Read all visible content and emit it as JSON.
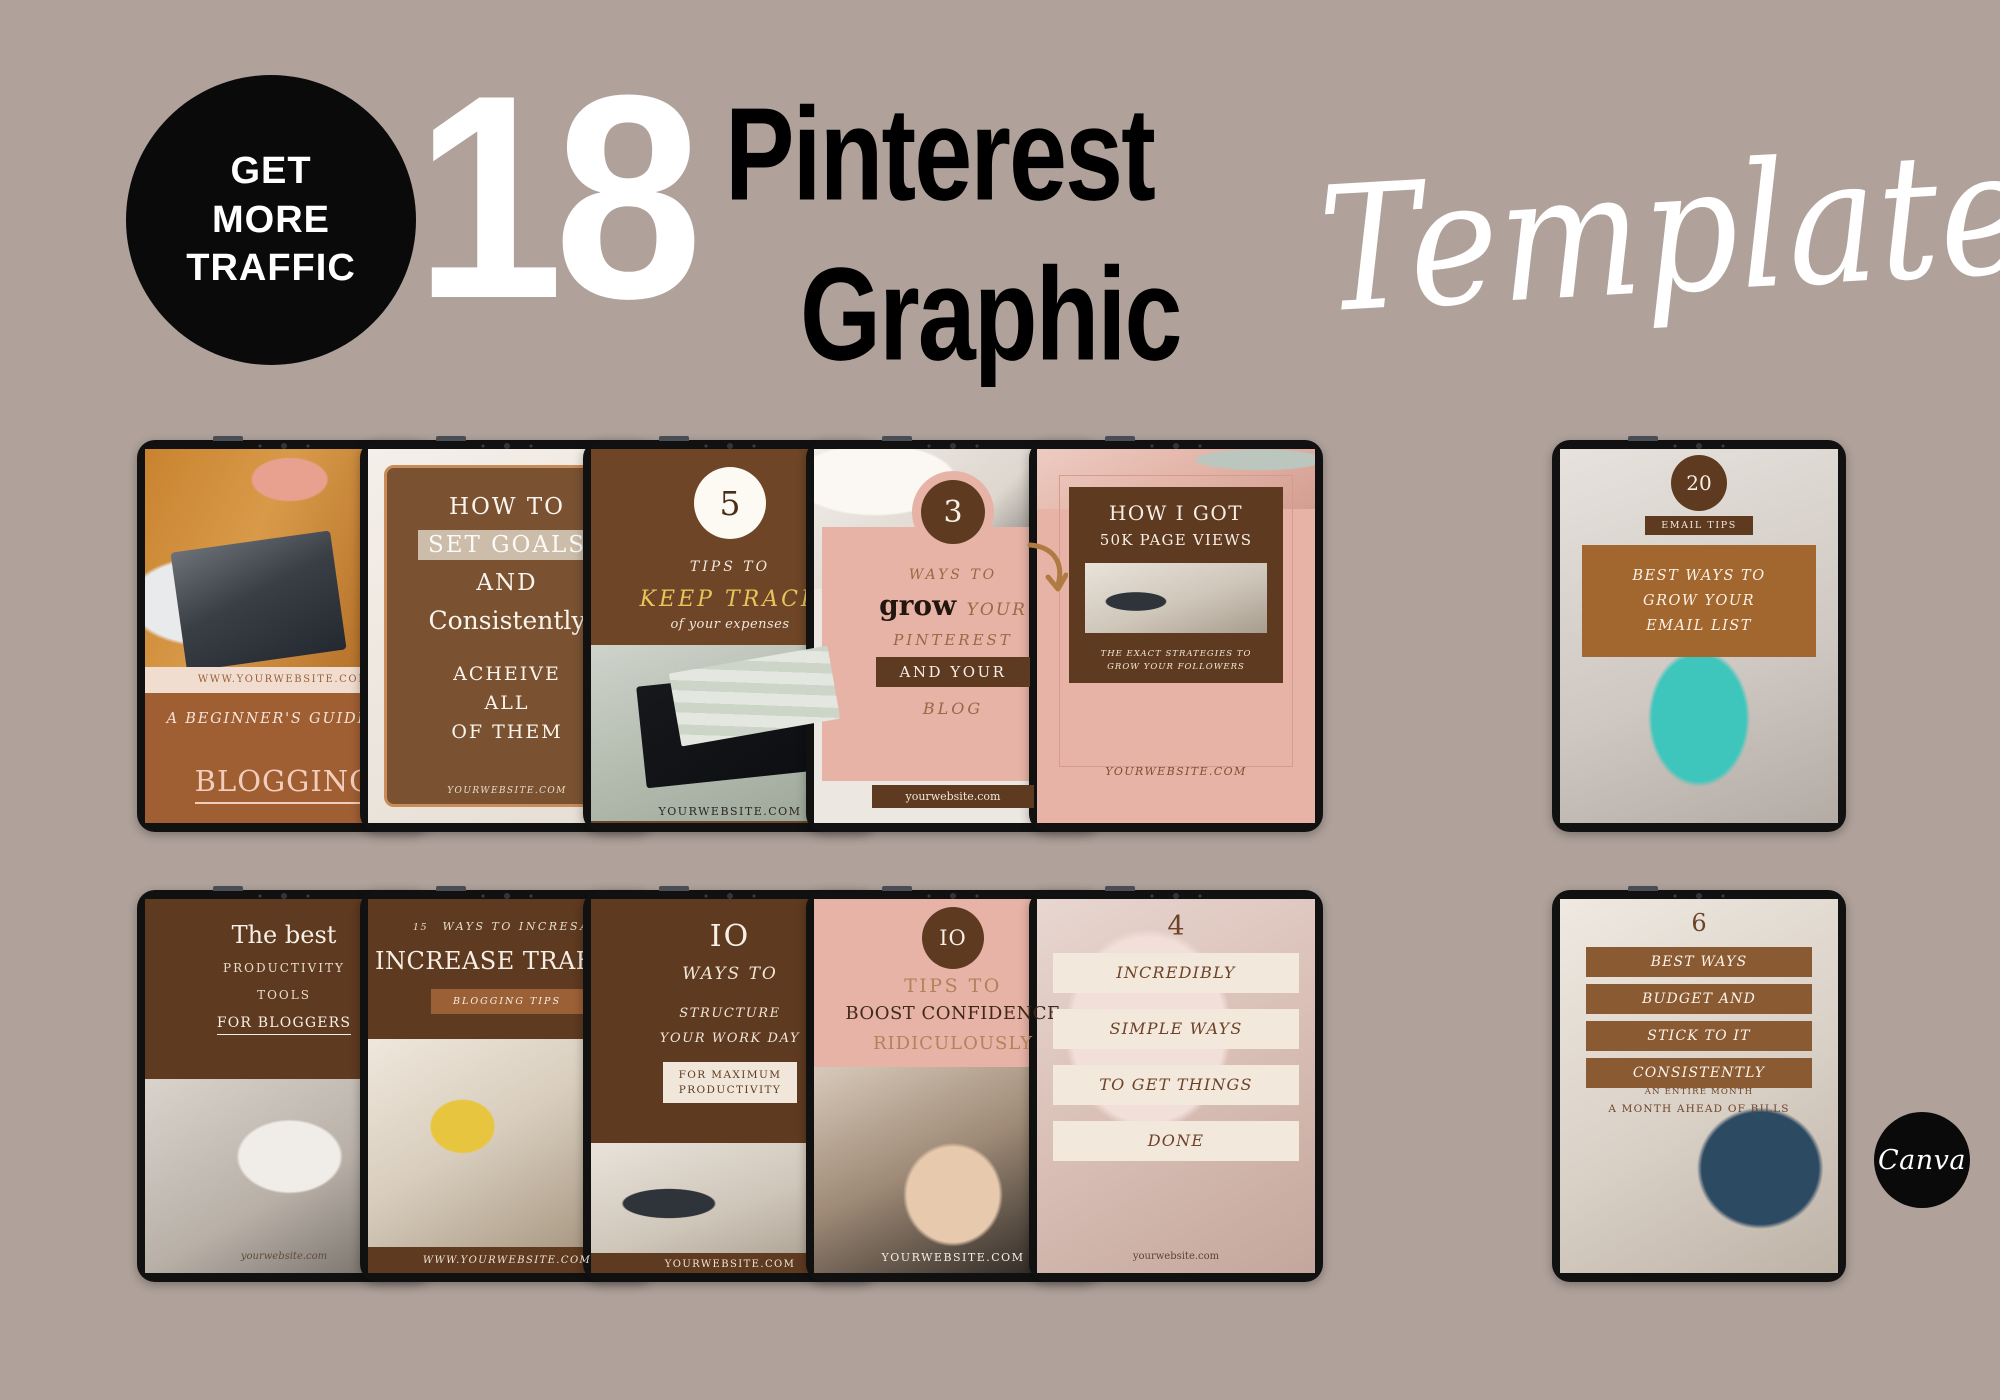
{
  "header": {
    "badge_lines": [
      "GET",
      "MORE",
      "TRAFFIC"
    ],
    "count": "18",
    "title_line1": "Pinterest",
    "title_line2": "Graphic",
    "script_word": "Templates"
  },
  "brand": {
    "canva_label": "Canva",
    "bg_color": "#b0a29b",
    "dark_brown": "#5c3a22",
    "mid_brown": "#7a4f2e",
    "light_brown": "#a05f33",
    "blush": "#e4b0a5",
    "cream": "#f1e5da",
    "gold": "#e5c65a"
  },
  "row1": [
    {
      "id": "beginners-guide-blogging",
      "photo": "ph-desk",
      "url_strip": "WWW.YOURWEBSITE.COM",
      "eyebrow": "A BEGINNER'S GUIDE TO",
      "headline": "BLOGGING"
    },
    {
      "id": "how-to-set-goals",
      "photo": "ph-hair",
      "line1": "HOW TO",
      "line2": "SET GOALS",
      "line3": "AND",
      "line4": "Consistently",
      "line5": "ACHEIVE",
      "line6": "ALL",
      "line7": "OF THEM",
      "footer": "YOURWEBSITE.COM"
    },
    {
      "id": "keep-track-expenses",
      "photo": "ph-money",
      "number": "5",
      "line1": "TIPS TO",
      "line2": "KEEP TRACK",
      "line3": "of your expenses",
      "footer": "YOURWEBSITE.COM"
    },
    {
      "id": "grow-pinterest-blog",
      "photo": "ph-pinterest",
      "number": "3",
      "line1": "WAYS TO",
      "line2a": "grow",
      "line2b": "YOUR",
      "line3": "PINTEREST",
      "line4": "AND YOUR",
      "line5": "BLOG",
      "footer": "yourwebsite.com"
    },
    {
      "id": "how-i-got-50k",
      "photo": "ph-lapdesk",
      "line1": "HOW I GOT",
      "line2": "50K PAGE VIEWS",
      "line3": "THE EXACT STRATEGIES TO",
      "line4": "GROW YOUR FOLLOWERS",
      "footer": "YOURWEBSITE.COM"
    },
    {
      "id": "grow-email-list",
      "photo": "ph-typing",
      "number": "20",
      "tag": "EMAIL TIPS",
      "line1": "BEST WAYS TO",
      "line2": "GROW YOUR",
      "line3": "EMAIL LIST"
    }
  ],
  "row2": [
    {
      "id": "best-productivity-tools",
      "photo": "ph-sofa",
      "line1": "The best",
      "line2": "PRODUCTIVITY",
      "line3": "TOOLS",
      "line4": "FOR BLOGGERS",
      "footer": "yourwebsite.com"
    },
    {
      "id": "increase-traffic",
      "photo": "ph-plant",
      "eyebrow_num": "15",
      "eyebrow": "WAYS TO INCRESAE",
      "headline": "INCREASE TRAFFIC",
      "tag": "BLOGGING TIPS",
      "footer": "WWW.YOURWEBSITE.COM"
    },
    {
      "id": "structure-work-day",
      "photo": "ph-work",
      "number": "IO",
      "line1": "WAYS TO",
      "line2": "STRUCTURE",
      "line3": "YOUR WORK DAY",
      "tag1": "FOR MAXIMUM",
      "tag2": "PRODUCTIVITY",
      "footer": "YOURWEBSITE.COM"
    },
    {
      "id": "boost-confidence",
      "photo": "ph-laugh",
      "number": "IO",
      "line1": "TIPS TO",
      "line2": "BOOST CONFIDENCE",
      "line3": "RIDICULOUSLY",
      "footer": "YOURWEBSITE.COM"
    },
    {
      "id": "get-things-done",
      "photo": "ph-blur",
      "number": "4",
      "bars": [
        "INCREDIBLY",
        "SIMPLE WAYS",
        "TO GET THINGS",
        "DONE"
      ],
      "footer": "yourwebsite.com"
    },
    {
      "id": "budget-stick-to-it",
      "photo": "ph-bills",
      "number": "6",
      "bars": [
        "BEST WAYS",
        "BUDGET AND",
        "STICK TO IT",
        "CONSISTENTLY"
      ],
      "sub1": "AN ENTIRE MONTH",
      "sub2": "A MONTH AHEAD OF BILLS"
    }
  ]
}
